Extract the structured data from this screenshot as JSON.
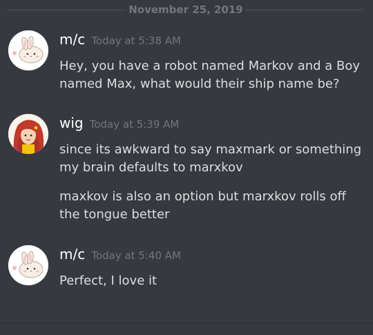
{
  "date_divider": "November 25, 2019",
  "messages": [
    {
      "username": "m/c",
      "timestamp": "Today at 5:38 AM",
      "avatar": "bunny-avatar",
      "lines": [
        "Hey, you have a robot named Markov and a Boy named Max, what would their ship name be?"
      ]
    },
    {
      "username": "wig",
      "timestamp": "Today at 5:39 AM",
      "avatar": "red-haired-character-avatar",
      "lines": [
        "since its awkward to say maxmark or something my brain defaults to marxkov",
        "maxkov is also an option but marxkov rolls off the tongue better"
      ]
    },
    {
      "username": "m/c",
      "timestamp": "Today at 5:40 AM",
      "avatar": "bunny-avatar",
      "lines": [
        "Perfect, I love it"
      ]
    }
  ],
  "colors": {
    "background": "#36393f",
    "username": "#ffffff",
    "timestamp": "#72767d",
    "message_text": "#dcddde",
    "divider": "#4f545c"
  }
}
